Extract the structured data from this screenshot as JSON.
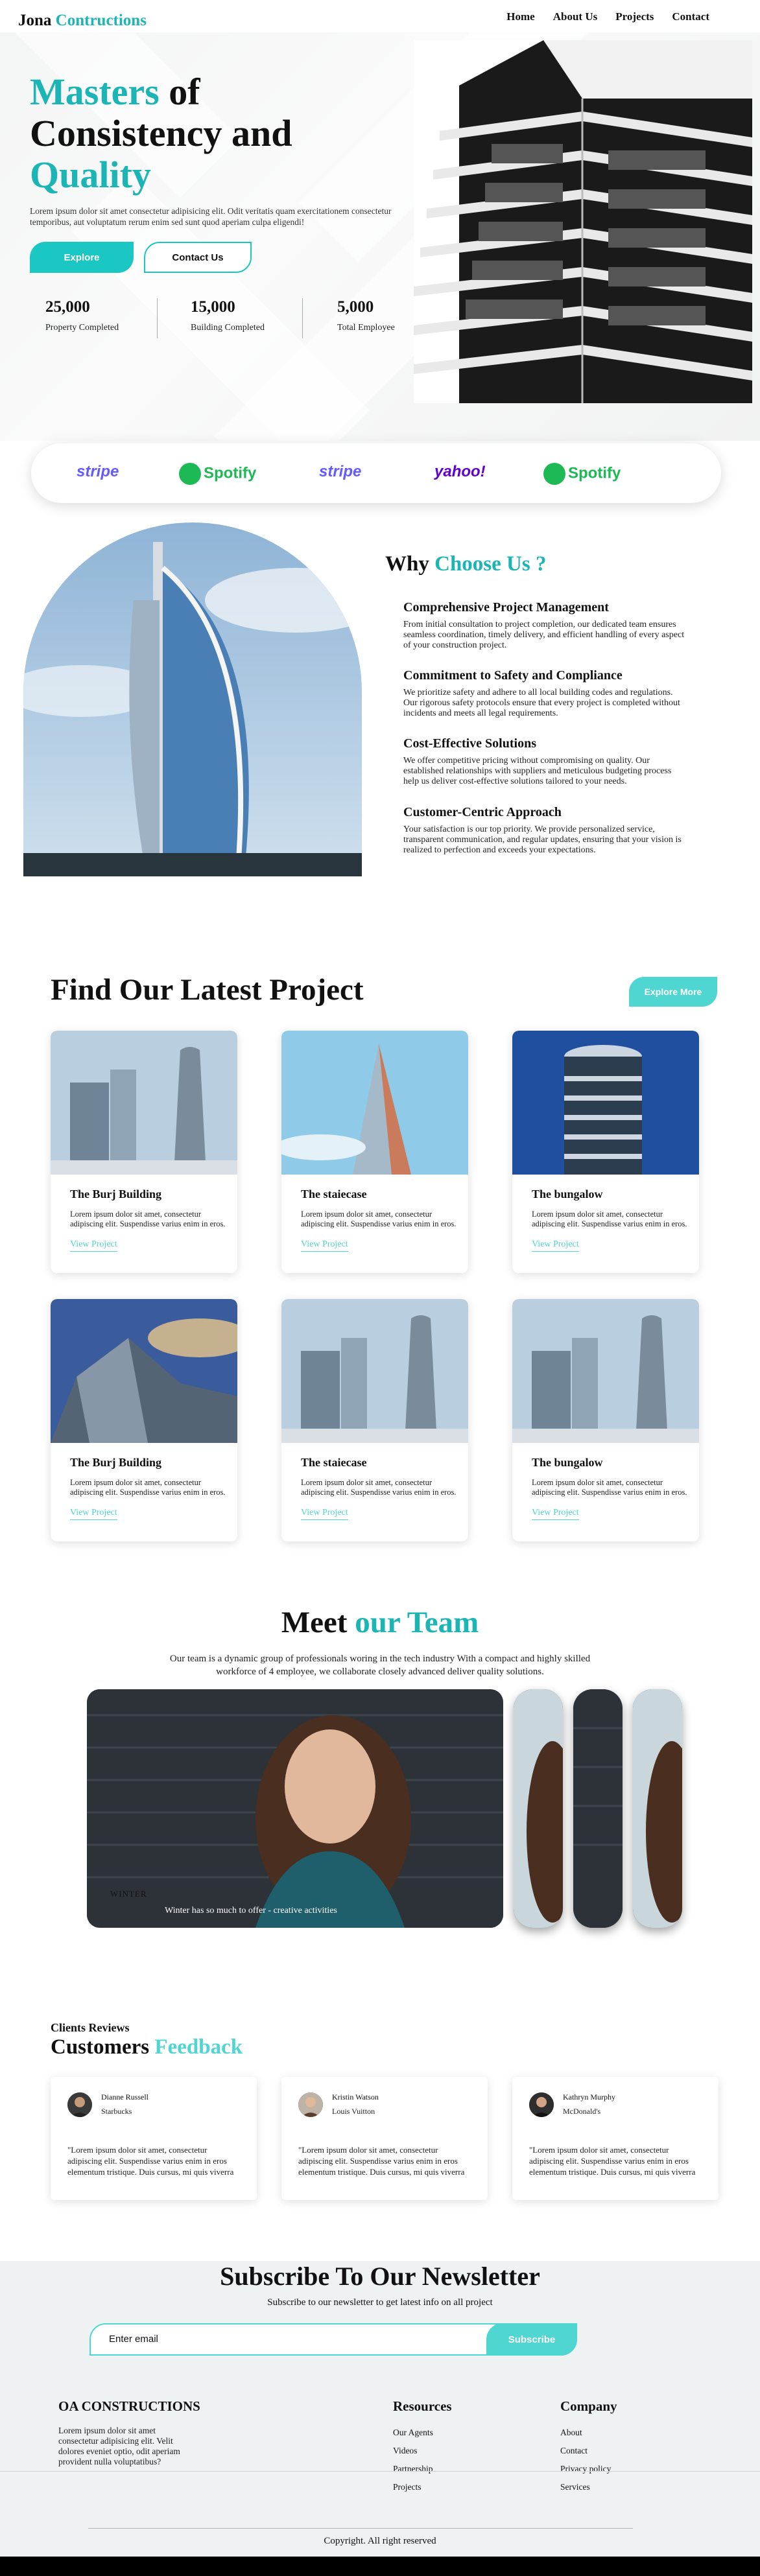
{
  "nav": {
    "logo_a": "Jona",
    "logo_b": "Contructions",
    "links": [
      "Home",
      "About Us",
      "Projects",
      "Contact"
    ]
  },
  "hero": {
    "title_1": "Masters",
    "title_2": " of",
    "title_3": "Consistency and",
    "title_4": "Quality",
    "description": "Lorem ipsum dolor sit amet consectetur adipisicing elit. Odit veritatis quam exercitationem consectetur temporibus, aut voluptatum rerum enim sed sunt quod aperiam culpa eligendi!",
    "explore_label": "Explore",
    "contact_label": "Contact Us",
    "stats": [
      {
        "value": "25,000",
        "label": "Property Completed"
      },
      {
        "value": "15,000",
        "label": "Building Completed"
      },
      {
        "value": "5,000",
        "label": "Total Employee"
      }
    ]
  },
  "brands": [
    "stripe",
    "Spotify",
    "stripe",
    "yahoo!",
    "Spotify"
  ],
  "why": {
    "title_a": "Why ",
    "title_b": "Choose Us ?",
    "items": [
      {
        "title": "Comprehensive Project Management",
        "text": "From initial consultation to project completion, our dedicated team ensures seamless coordination, timely delivery, and efficient handling of every aspect of your construction project."
      },
      {
        "title": "Commitment to Safety and Compliance",
        "text": "We prioritize safety and adhere to all local building codes and regulations. Our rigorous safety protocols ensure that every project is completed without incidents and meets all legal requirements."
      },
      {
        "title": "Cost-Effective Solutions",
        "text": "We offer competitive pricing without compromising on quality. Our established relationships with suppliers and meticulous budgeting process help us deliver cost-effective solutions tailored to your needs."
      },
      {
        "title": "Customer-Centric Approach",
        "text": "Your satisfaction is our top priority. We provide personalized service, transparent communication, and regular updates, ensuring that your vision is realized to perfection and exceeds your expectations."
      }
    ]
  },
  "projects": {
    "title": "Find Our Latest Project",
    "more_label": "Explore More",
    "view_label": "View Project",
    "cards": [
      {
        "title": "The Burj Building",
        "text": "Lorem ipsum dolor sit amet, consectetur adipiscing elit. Suspendisse varius enim in eros.",
        "image": "twin-towers"
      },
      {
        "title": "The staiecase",
        "text": "Lorem ipsum dolor sit amet, consectetur adipiscing elit. Suspendisse varius enim in eros.",
        "image": "glass-spire"
      },
      {
        "title": "The bungalow",
        "text": "Lorem ipsum dolor sit amet, consectetur adipiscing elit. Suspendisse varius enim in eros.",
        "image": "round-tower"
      },
      {
        "title": "The Burj Building",
        "text": "Lorem ipsum dolor sit amet, consectetur adipiscing elit. Suspendisse varius enim in eros.",
        "image": "angular-facade"
      },
      {
        "title": "The staiecase",
        "text": "Lorem ipsum dolor sit amet, consectetur adipiscing elit. Suspendisse varius enim in eros.",
        "image": "twin-towers"
      },
      {
        "title": "The bungalow",
        "text": "Lorem ipsum dolor sit amet, consectetur adipiscing elit. Suspendisse varius enim in eros.",
        "image": "twin-towers"
      }
    ]
  },
  "team": {
    "title_a": "Meet ",
    "title_b": "our Team",
    "description": "Our team is a dynamic group of professionals woring in the tech industry With a compact and highly skilled workforce of 4 employee, we collaborate closely advanced deliver quality solutions.",
    "member_name": "WINTER",
    "caption": "Winter has so much to offer - creative activities"
  },
  "reviews": {
    "subtitle": "Clients Reviews",
    "title_a": "Customers ",
    "title_b": "Feedback",
    "items": [
      {
        "name": "Dianne Russell",
        "company": "Starbucks",
        "text": "\"Lorem ipsum dolor sit amet, consectetur adipiscing elit. Suspendisse varius enim in eros elementum tristique. Duis cursus, mi quis viverra"
      },
      {
        "name": "Kristin Watson",
        "company": "Louis Vuitton",
        "text": "\"Lorem ipsum dolor sit amet, consectetur adipiscing elit. Suspendisse varius enim in eros elementum tristique. Duis cursus, mi quis viverra"
      },
      {
        "name": "Kathryn Murphy",
        "company": "McDonald's",
        "text": "\"Lorem ipsum dolor sit amet, consectetur adipiscing elit. Suspendisse varius enim in eros elementum tristique. Duis cursus, mi quis viverra"
      }
    ]
  },
  "newsletter": {
    "title": "Subscribe To Our Newsletter",
    "subtitle": "Subscribe to our newsletter to get latest info on all project",
    "placeholder": "Enter email",
    "button": "Subscribe"
  },
  "footer": {
    "brand": "OA CONSTRUCTIONS",
    "description": "Lorem ipsum dolor sit amet consectetur adipisicing elit. Velit dolores eveniet optio, odit aperiam provident nulla voluptatibus?",
    "resources_title": "Resources",
    "resources": [
      "Our Agents",
      "Videos",
      "Partnership",
      "Projects"
    ],
    "company_title": "Company",
    "company": [
      "About",
      "Contact",
      "Privacy policy",
      "Services"
    ],
    "copyright": "Copyright. All right reserved"
  },
  "colors": {
    "accent": "#1bb5b5",
    "button": "#4fd6d0",
    "stripe": "#635bff",
    "spotify": "#1db954",
    "yahoo": "#6001d2"
  }
}
